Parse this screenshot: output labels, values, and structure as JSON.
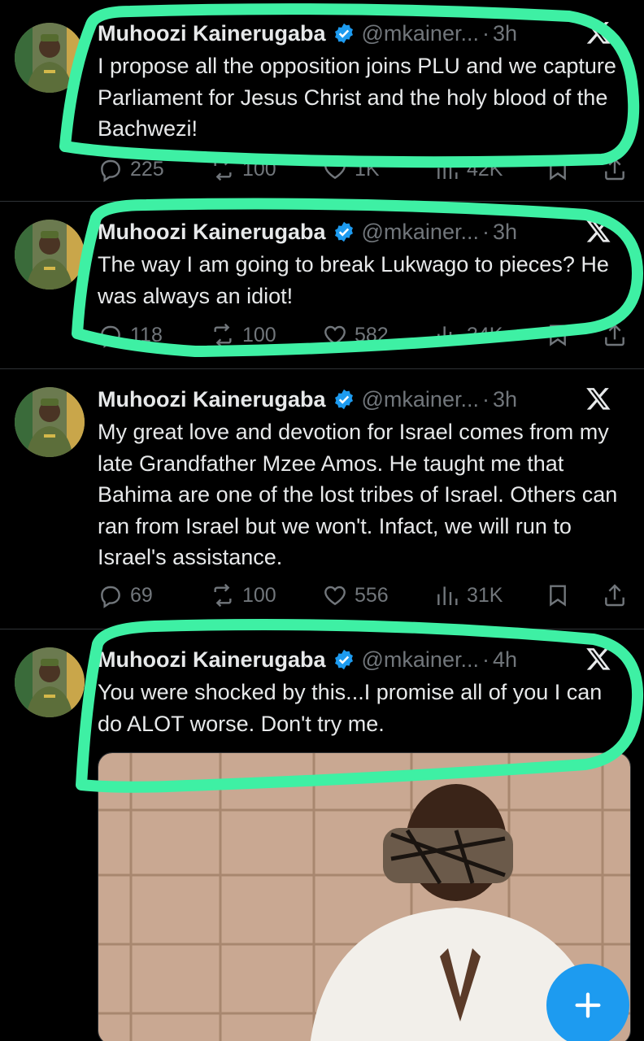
{
  "tweets": [
    {
      "name": "Muhoozi Kainerugaba",
      "handle": "@mkainer...",
      "time": "3h",
      "text": "I propose all the opposition joins PLU and we capture Parliament for Jesus Christ and the holy blood of the Bachwezi!",
      "replies": "225",
      "reposts": "100",
      "likes": "1K",
      "views": "42K"
    },
    {
      "name": "Muhoozi Kainerugaba",
      "handle": "@mkainer...",
      "time": "3h",
      "text": "The way I am going to break Lukwago to pieces? He was always an idiot!",
      "replies": "118",
      "reposts": "100",
      "likes": "582",
      "views": "34K"
    },
    {
      "name": "Muhoozi Kainerugaba",
      "handle": "@mkainer...",
      "time": "3h",
      "text": "My great love and devotion for Israel comes from my late Grandfather Mzee Amos. He taught me that Bahima are one of the lost tribes of Israel. Others can ran from Israel but we won't. Infact, we will run to Israel's assistance.",
      "replies": "69",
      "reposts": "100",
      "likes": "556",
      "views": "31K"
    },
    {
      "name": "Muhoozi Kainerugaba",
      "handle": "@mkainer...",
      "time": "4h",
      "text": "You were shocked by this...I promise all of you I can do ALOT worse. Don't try me."
    }
  ],
  "separator": "·",
  "icons": [
    "verified-badge-icon",
    "x-logo-icon",
    "reply-icon",
    "repost-icon",
    "like-icon",
    "views-icon",
    "bookmark-icon",
    "share-icon",
    "compose-plus-icon"
  ],
  "colors": {
    "background": "#000000",
    "text": "#e7e9ea",
    "secondary": "#71767b",
    "accent": "#1d9bf0",
    "highlight": "#3ef0a4"
  }
}
